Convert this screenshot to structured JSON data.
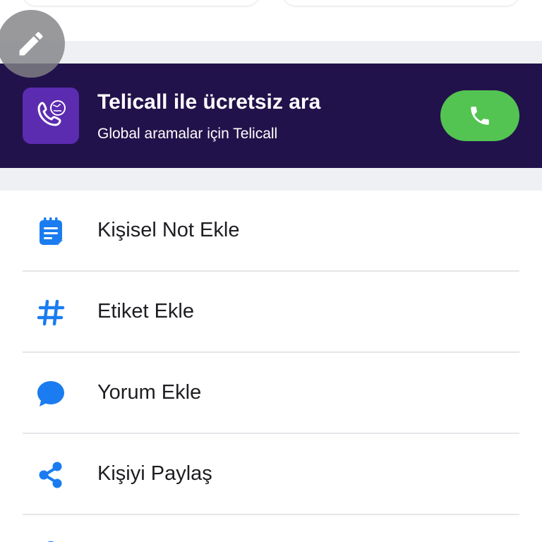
{
  "promo": {
    "title": "Telicall ile ücretsiz ara",
    "subtitle": "Global aramalar için Telicall",
    "logo_icon": "telicall-phone-globe-icon",
    "call_icon": "phone-icon"
  },
  "fab": {
    "icon": "pencil-icon"
  },
  "menu": {
    "items": [
      {
        "label": "Kişisel Not Ekle",
        "icon": "note-icon"
      },
      {
        "label": "Etiket Ekle",
        "icon": "hashtag-icon"
      },
      {
        "label": "Yorum Ekle",
        "icon": "comment-bubble-icon"
      },
      {
        "label": "Kişiyi Paylaş",
        "icon": "share-icon"
      }
    ]
  },
  "colors": {
    "promo_bg": "#22124b",
    "logo_bg": "#5b2bb0",
    "call_green": "#53c452",
    "icon_blue": "#1a7cf0",
    "band_gray": "#eff0f4",
    "fab_gray": "#828286"
  }
}
